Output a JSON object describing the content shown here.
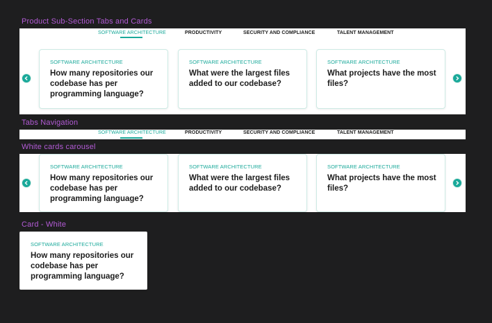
{
  "labels": {
    "section1": "Product Sub-Section Tabs and Cards",
    "section2": "Tabs Navigation",
    "section3": "White cards carousel",
    "section4": "Card - White"
  },
  "tabs": [
    {
      "label": "SOFTWARE ARCHITECTURE",
      "active": true
    },
    {
      "label": "PRODUCTIVITY",
      "active": false
    },
    {
      "label": "SECURITY AND COMPLIANCE",
      "active": false
    },
    {
      "label": "TALENT MANAGEMENT",
      "active": false
    }
  ],
  "cards": [
    {
      "kicker": "SOFTWARE ARCHITECTURE",
      "question": "How many repositories our codebase has per programming language?"
    },
    {
      "kicker": "SOFTWARE ARCHITECTURE",
      "question": "What were the largest files added to our codebase?"
    },
    {
      "kicker": "SOFTWARE ARCHITECTURE",
      "question": "What projects have the most files?"
    }
  ],
  "icons": {
    "prev": "chevron-left-icon",
    "next": "chevron-right-icon"
  },
  "colors": {
    "accent": "#1aa99a",
    "label": "#b35bd6",
    "background": "#1e1e1f"
  }
}
